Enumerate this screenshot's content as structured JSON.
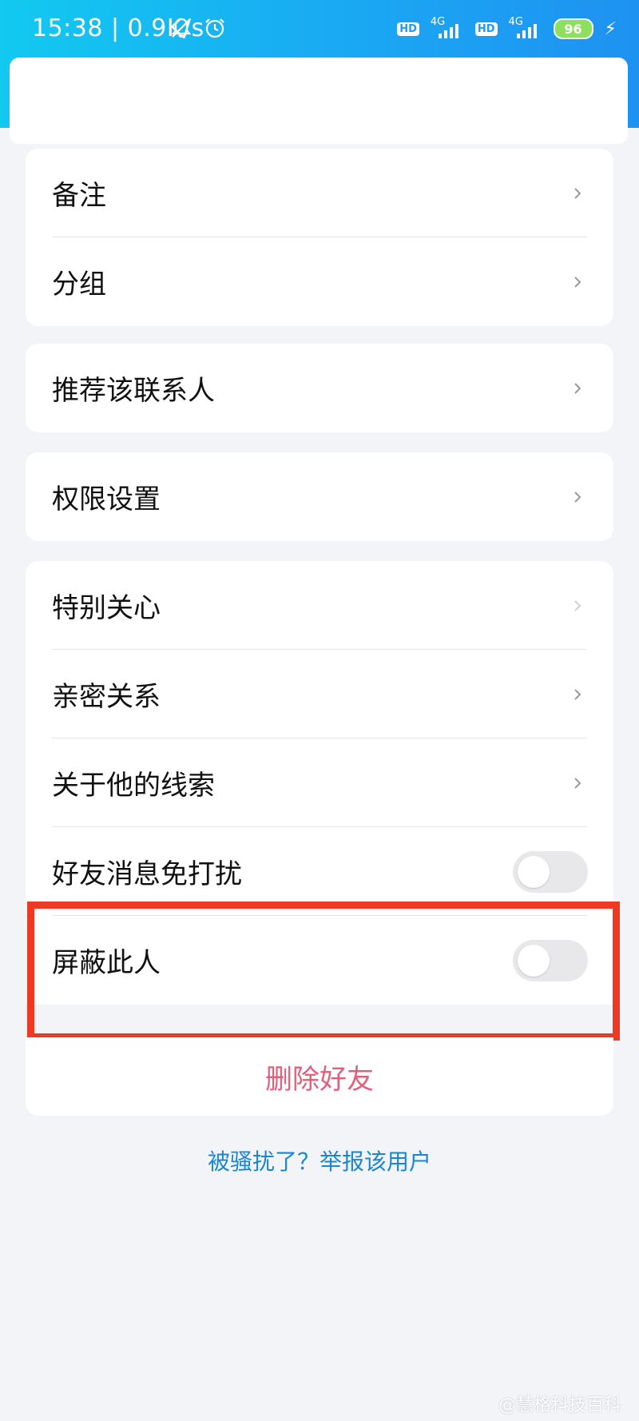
{
  "status_bar": {
    "time": "15:38",
    "speed": "0.9K/s",
    "sim1": {
      "hd": "HD",
      "net": "4G"
    },
    "sim2": {
      "hd": "HD",
      "net": "4G"
    },
    "battery": "96"
  },
  "settings": {
    "group1": [
      {
        "label": "备注",
        "control": "chevron"
      },
      {
        "label": "分组",
        "control": "chevron"
      }
    ],
    "group2": [
      {
        "label": "推荐该联系人",
        "control": "chevron"
      }
    ],
    "group3": [
      {
        "label": "权限设置",
        "control": "chevron"
      }
    ],
    "group4": [
      {
        "label": "特别关心",
        "control": "chevron"
      },
      {
        "label": "亲密关系",
        "control": "chevron"
      },
      {
        "label": "关于他的线索",
        "control": "chevron"
      },
      {
        "label": "好友消息免打扰",
        "control": "toggle",
        "on": false
      },
      {
        "label": "屏蔽此人",
        "control": "toggle",
        "on": false
      }
    ]
  },
  "delete_friend": "删除好友",
  "report_link": "被骚扰了？举报该用户",
  "watermark": "@慧格科技百科",
  "colors": {
    "header_gradient_start": "#12c9f0",
    "header_gradient_end": "#1e92f1",
    "highlight_border": "#ee3a22",
    "delete_text": "#e0607a",
    "link_text": "#1a86cf"
  }
}
